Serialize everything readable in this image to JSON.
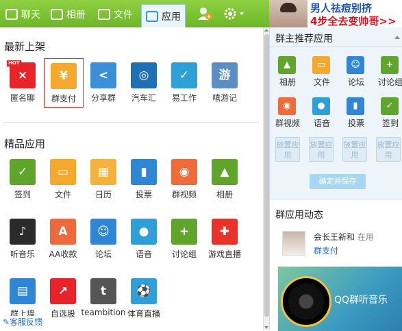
{
  "tabs": [
    {
      "label": "聊天",
      "icon": "chat-icon"
    },
    {
      "label": "相册",
      "icon": "photo-icon"
    },
    {
      "label": "文件",
      "icon": "folder-icon"
    },
    {
      "label": "应用",
      "icon": "apps-icon",
      "active": true
    }
  ],
  "ad": {
    "line1": "男人祛痘别挤",
    "line2": "4步全去变帅哥>>"
  },
  "new_section": {
    "title": "最新上架",
    "apps": [
      {
        "label": "匿名聊",
        "icon": "anonymous-chat-icon",
        "color": "#e8232a",
        "glyph": "×",
        "hot": "HOT"
      },
      {
        "label": "群支付",
        "icon": "group-pay-icon",
        "color": "#f4a92c",
        "glyph": "¥"
      },
      {
        "label": "分享群",
        "icon": "share-icon",
        "color": "#3a8fd8",
        "glyph": "<"
      },
      {
        "label": "汽车汇",
        "icon": "car-icon",
        "color": "#1f6fb4",
        "glyph": "◎"
      },
      {
        "label": "易工作",
        "icon": "work-icon",
        "color": "#2f9fd8",
        "glyph": "✓"
      },
      {
        "label": "嘻游记",
        "icon": "travel-icon",
        "color": "#5b8ec4",
        "glyph": "游"
      }
    ]
  },
  "premium_section": {
    "title": "精品应用",
    "apps": [
      {
        "label": "签到",
        "icon": "checkin-icon",
        "color": "#5fa52c",
        "glyph": "✓"
      },
      {
        "label": "文件",
        "icon": "folder-icon",
        "color": "#f4a92c",
        "glyph": "▭"
      },
      {
        "label": "日历",
        "icon": "calendar-icon",
        "color": "#f5b33d",
        "glyph": "▦"
      },
      {
        "label": "投票",
        "icon": "vote-icon",
        "color": "#2f86d4",
        "glyph": "▮"
      },
      {
        "label": "群视频",
        "icon": "video-icon",
        "color": "#f06b3a",
        "glyph": "◉"
      },
      {
        "label": "相册",
        "icon": "album-icon",
        "color": "#5fa52c",
        "glyph": "▲"
      },
      {
        "label": "听音乐",
        "icon": "music-icon",
        "color": "#2b2b2b",
        "glyph": "♪"
      },
      {
        "label": "AA收款",
        "icon": "aa-payment-icon",
        "color": "#ef6a3a",
        "glyph": "A"
      },
      {
        "label": "论坛",
        "icon": "forum-icon",
        "color": "#2f86d4",
        "glyph": "☺"
      },
      {
        "label": "语音",
        "icon": "voice-icon",
        "color": "#2f9fd8",
        "glyph": "●"
      },
      {
        "label": "讨论组",
        "icon": "discussion-icon",
        "color": "#5fa52c",
        "glyph": "+"
      },
      {
        "label": "游戏直播",
        "icon": "game-live-icon",
        "color": "#e8332a",
        "glyph": "✚"
      },
      {
        "label": "群上墙",
        "icon": "presentation-icon",
        "color": "#2f86d4",
        "glyph": "▤"
      },
      {
        "label": "自选股",
        "icon": "stock-icon",
        "color": "#e8232a",
        "glyph": "↗"
      },
      {
        "label": "teambition",
        "icon": "teambition-icon",
        "color": "#555555",
        "glyph": "t"
      },
      {
        "label": "体育直播",
        "icon": "sports-live-icon",
        "color": "#2f9fd8",
        "glyph": "⚽"
      }
    ]
  },
  "feedback_label": "客服反馈",
  "recommend": {
    "title": "群主推荐应用",
    "apps": [
      {
        "label": "相册",
        "icon": "album-icon",
        "color": "#5fa52c",
        "glyph": "▲"
      },
      {
        "label": "文件",
        "icon": "folder-icon",
        "color": "#f4a92c",
        "glyph": "▭"
      },
      {
        "label": "论坛",
        "icon": "forum-icon",
        "color": "#2f86d4",
        "glyph": "☺"
      },
      {
        "label": "讨论组",
        "icon": "discussion-icon",
        "color": "#5fa52c",
        "glyph": "+"
      },
      {
        "label": "群视频",
        "icon": "video-icon",
        "color": "#f06b3a",
        "glyph": "◉"
      },
      {
        "label": "语音",
        "icon": "voice-icon",
        "color": "#2f9fd8",
        "glyph": "●"
      },
      {
        "label": "投票",
        "icon": "vote-icon",
        "color": "#2f86d4",
        "glyph": "▮"
      },
      {
        "label": "签到",
        "icon": "checkin-icon",
        "color": "#5fa52c",
        "glyph": "✓"
      }
    ],
    "slot_label": "放置应用",
    "save_label": "确定并保存"
  },
  "activity": {
    "title": "群应用动态",
    "user": "会长王新和",
    "action": "在用",
    "app": "群支付",
    "banner_text": "QQ群听音乐"
  }
}
